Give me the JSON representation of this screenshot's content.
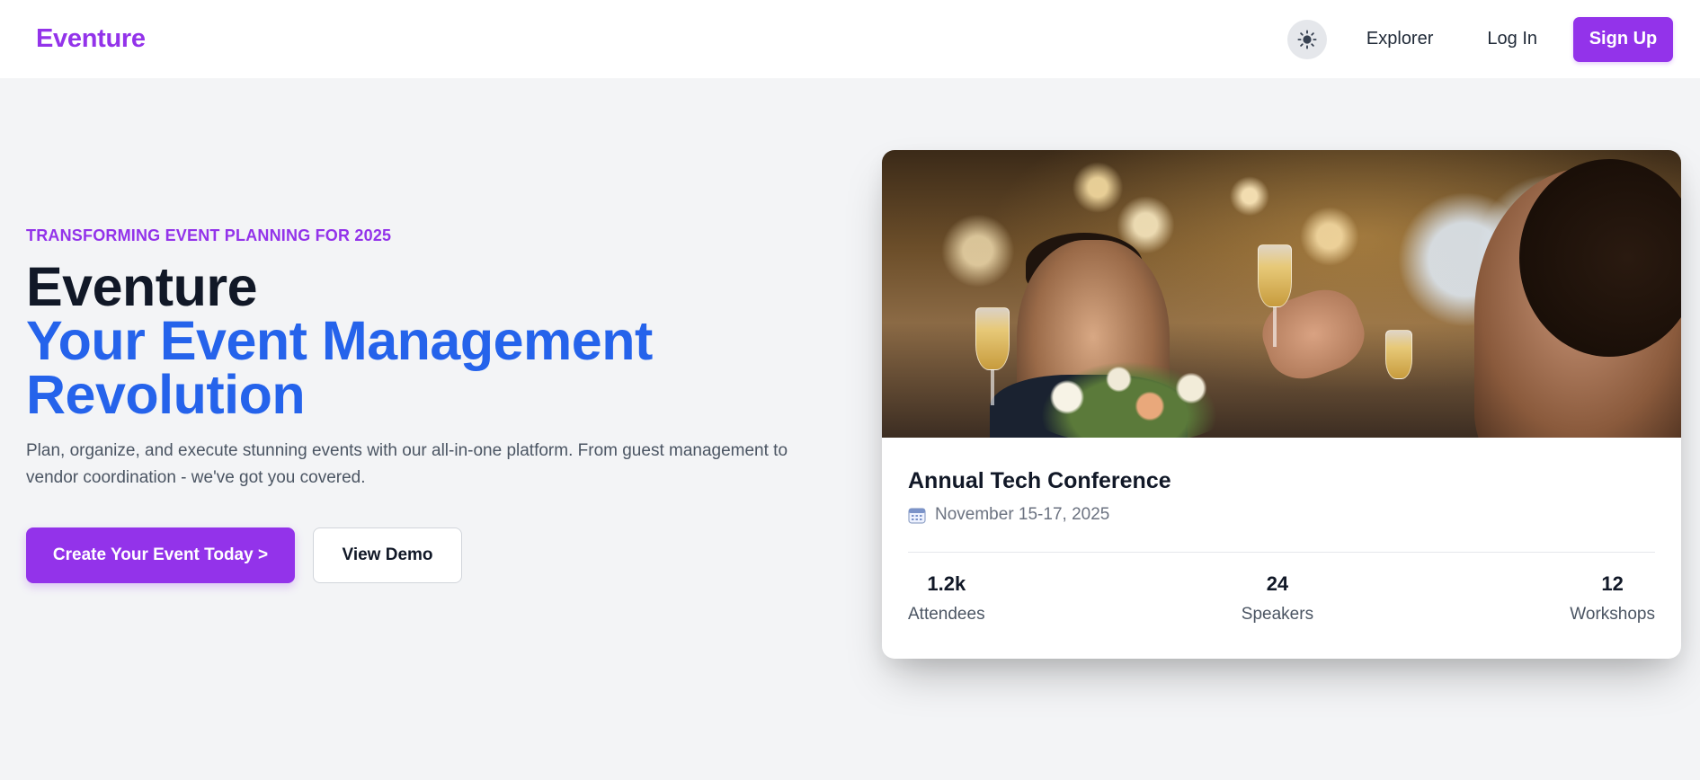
{
  "header": {
    "brand": "Eventure",
    "nav_links": [
      "Explorer",
      "Log In"
    ],
    "signup_label": "Sign Up",
    "theme_toggle_icon": "sun-icon"
  },
  "hero": {
    "tagline": "TRANSFORMING EVENT PLANNING FOR 2025",
    "headline_line1": "Eventure",
    "headline_line2": "Your Event Management Revolution",
    "description": "Plan, organize, and execute stunning events with our all-in-one platform. From guest management to vendor coordination - we've got you covered.",
    "primary_cta": "Create Your Event Today >",
    "secondary_cta": "View Demo"
  },
  "event_card": {
    "image_icon": "celebration-photo",
    "title": "Annual Tech Conference",
    "date_icon": "calendar-icon",
    "date": "November 15-17, 2025",
    "stats": [
      {
        "value": "1.2k",
        "label": "Attendees"
      },
      {
        "value": "24",
        "label": "Speakers"
      },
      {
        "value": "12",
        "label": "Workshops"
      }
    ]
  },
  "colors": {
    "brand": "#9333ea",
    "accent_blue": "#2563eb",
    "background": "#f3f4f6",
    "text_dark": "#111827",
    "text_muted": "#4b5563"
  }
}
